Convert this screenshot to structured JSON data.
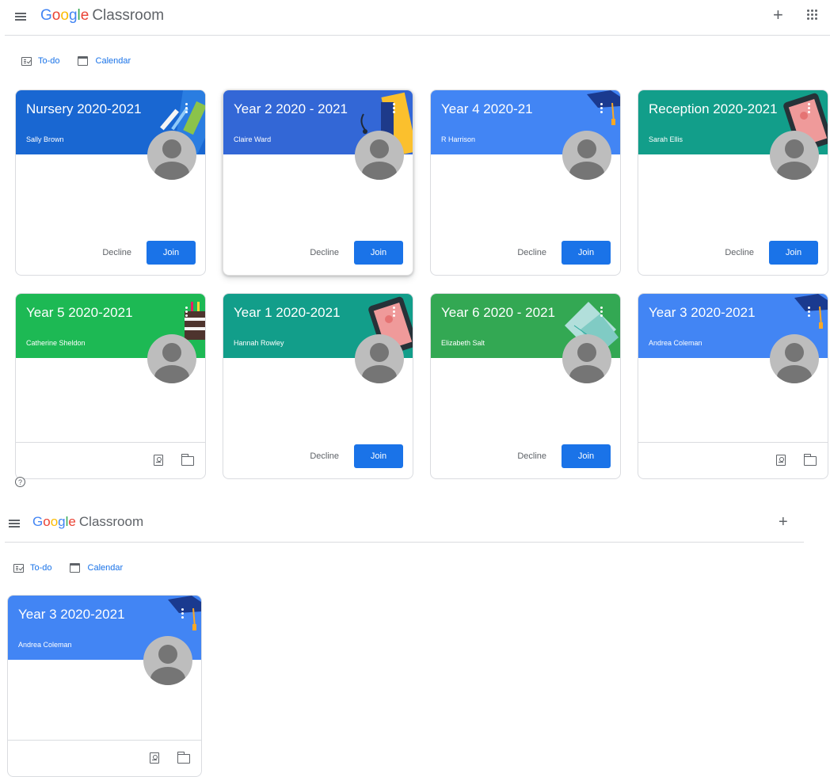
{
  "screen1": {
    "brand": {
      "google": [
        "G",
        "o",
        "o",
        "g",
        "l",
        "e"
      ],
      "product": "Classroom"
    },
    "nav": {
      "todo": "To-do",
      "calendar": "Calendar"
    },
    "help_glyph": "?",
    "cards": [
      {
        "title": "Nursery 2020-2021",
        "teacher": "Sally Brown",
        "color": "#1967d2",
        "theme": "pencil-theme",
        "actions": "invite",
        "decline": "Decline",
        "join": "Join"
      },
      {
        "title": "Year 2 2020 - 2021",
        "teacher": "Claire Ward",
        "color": "#3367d6",
        "theme": "book-theme",
        "actions": "invite",
        "decline": "Decline",
        "join": "Join"
      },
      {
        "title": "Year 4 2020-21",
        "teacher": "R Harrison",
        "color": "#4285f4",
        "theme": "graduation-cap-theme",
        "actions": "invite",
        "decline": "Decline",
        "join": "Join"
      },
      {
        "title": "Reception 2020-2021",
        "teacher": "Sarah Ellis",
        "color": "#129e8a",
        "theme": "tablet-theme",
        "actions": "invite",
        "decline": "Decline",
        "join": "Join"
      },
      {
        "title": "Year 5 2020-2021",
        "teacher": "Catherine Sheldon",
        "color": "#1db954",
        "theme": "cake-theme",
        "actions": "enrolled"
      },
      {
        "title": "Year 1 2020-2021",
        "teacher": "Hannah Rowley",
        "color": "#129e8a",
        "theme": "tablet-theme",
        "actions": "invite",
        "decline": "Decline",
        "join": "Join"
      },
      {
        "title": "Year 6 2020 - 2021",
        "teacher": "Elizabeth Salt",
        "color": "#33a853",
        "theme": "notebook-theme",
        "actions": "invite",
        "decline": "Decline",
        "join": "Join"
      },
      {
        "title": "Year 3 2020-2021",
        "teacher": "Andrea Coleman",
        "color": "#4285f4",
        "theme": "graduation-cap-theme",
        "actions": "enrolled"
      }
    ]
  },
  "screen2": {
    "brand": {
      "google": [
        "G",
        "o",
        "o",
        "g",
        "l",
        "e"
      ],
      "product": "Classroom"
    },
    "nav": {
      "todo": "To-do",
      "calendar": "Calendar"
    },
    "cards": [
      {
        "title": "Year 3 2020-2021",
        "teacher": "Andrea Coleman",
        "color": "#4285f4",
        "theme": "graduation-cap-theme",
        "actions": "enrolled"
      }
    ]
  }
}
